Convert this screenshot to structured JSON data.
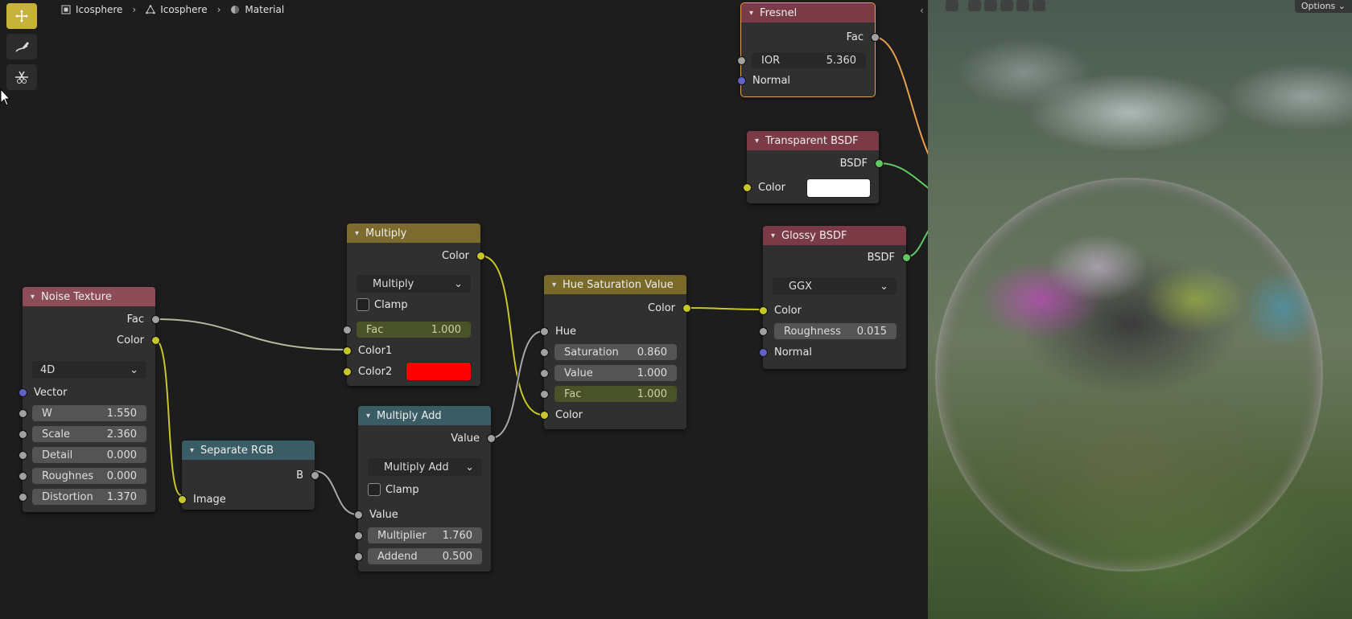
{
  "breadcrumb": {
    "object": "Icosphere",
    "mesh": "Icosphere",
    "material": "Material"
  },
  "viewport": {
    "options_label": "Options"
  },
  "colors": {
    "red_swatch": "#ff0000",
    "white_swatch": "#ffffff",
    "tool_active": "#c7b33a"
  },
  "tools": [
    {
      "icon": "select-box-icon"
    },
    {
      "icon": "annotate-icon"
    },
    {
      "icon": "cut-links-icon"
    }
  ],
  "nodes": {
    "fresnel": {
      "title": "Fresnel",
      "out_fac": "Fac",
      "ior_label": "IOR",
      "ior_value": "5.360",
      "normal": "Normal"
    },
    "transparent": {
      "title": "Transparent BSDF",
      "out_bsdf": "BSDF",
      "color": "Color"
    },
    "glossy": {
      "title": "Glossy BSDF",
      "out_bsdf": "BSDF",
      "distribution": "GGX",
      "color": "Color",
      "roughness_label": "Roughness",
      "roughness_value": "0.015",
      "normal": "Normal"
    },
    "multiply": {
      "title": "Multiply",
      "out_color": "Color",
      "mode": "Multiply",
      "clamp": "Clamp",
      "fac_label": "Fac",
      "fac_value": "1.000",
      "color1": "Color1",
      "color2": "Color2"
    },
    "hsv": {
      "title": "Hue Saturation Value",
      "out_color": "Color",
      "hue": "Hue",
      "sat_label": "Saturation",
      "sat_value": "0.860",
      "val_label": "Value",
      "val_value": "1.000",
      "fac_label": "Fac",
      "fac_value": "1.000",
      "color": "Color"
    },
    "noise": {
      "title": "Noise Texture",
      "out_fac": "Fac",
      "out_color": "Color",
      "dims": "4D",
      "vector": "Vector",
      "w_label": "W",
      "w_value": "1.550",
      "scale_label": "Scale",
      "scale_value": "2.360",
      "detail_label": "Detail",
      "detail_value": "0.000",
      "rough_label": "Roughnes",
      "rough_value": "0.000",
      "dist_label": "Distortion",
      "dist_value": "1.370"
    },
    "separate": {
      "title": "Separate RGB",
      "out_b": "B",
      "image": "Image"
    },
    "muladd": {
      "title": "Multiply Add",
      "out_value": "Value",
      "mode": "Multiply Add",
      "clamp": "Clamp",
      "value": "Value",
      "mult_label": "Multiplier",
      "mult_value": "1.760",
      "add_label": "Addend",
      "add_value": "0.500"
    }
  }
}
